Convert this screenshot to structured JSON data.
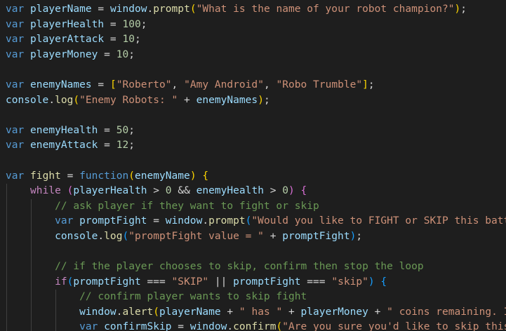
{
  "editor": {
    "language": "javascript",
    "theme": "dark",
    "colors": {
      "background": "#1e1e1e",
      "keyword": "#569cd6",
      "control": "#c586c0",
      "variable": "#9cdcfe",
      "function": "#dcdcaa",
      "string": "#ce9178",
      "number": "#b5cea8",
      "comment": "#6a9955",
      "bracket_level1": "#ffd700",
      "bracket_level2": "#da70d6",
      "bracket_level3": "#179fff"
    },
    "lines": [
      {
        "guides": 0,
        "tokens": [
          {
            "t": "kw",
            "v": "var"
          },
          {
            "t": "op",
            "v": " "
          },
          {
            "t": "var",
            "v": "playerName"
          },
          {
            "t": "op",
            "v": " = "
          },
          {
            "t": "var",
            "v": "window"
          },
          {
            "t": "op",
            "v": "."
          },
          {
            "t": "fn",
            "v": "prompt"
          },
          {
            "t": "br1",
            "v": "("
          },
          {
            "t": "str",
            "v": "\"What is the name of your robot champion?\""
          },
          {
            "t": "br1",
            "v": ")"
          },
          {
            "t": "op",
            "v": ";"
          }
        ]
      },
      {
        "guides": 0,
        "tokens": [
          {
            "t": "kw",
            "v": "var"
          },
          {
            "t": "op",
            "v": " "
          },
          {
            "t": "var",
            "v": "playerHealth"
          },
          {
            "t": "op",
            "v": " = "
          },
          {
            "t": "num",
            "v": "100"
          },
          {
            "t": "op",
            "v": ";"
          }
        ]
      },
      {
        "guides": 0,
        "tokens": [
          {
            "t": "kw",
            "v": "var"
          },
          {
            "t": "op",
            "v": " "
          },
          {
            "t": "var",
            "v": "playerAttack"
          },
          {
            "t": "op",
            "v": " = "
          },
          {
            "t": "num",
            "v": "10"
          },
          {
            "t": "op",
            "v": ";"
          }
        ]
      },
      {
        "guides": 0,
        "tokens": [
          {
            "t": "kw",
            "v": "var"
          },
          {
            "t": "op",
            "v": " "
          },
          {
            "t": "var",
            "v": "playerMoney"
          },
          {
            "t": "op",
            "v": " = "
          },
          {
            "t": "num",
            "v": "10"
          },
          {
            "t": "op",
            "v": ";"
          }
        ]
      },
      {
        "guides": 0,
        "tokens": []
      },
      {
        "guides": 0,
        "tokens": [
          {
            "t": "kw",
            "v": "var"
          },
          {
            "t": "op",
            "v": " "
          },
          {
            "t": "var",
            "v": "enemyNames"
          },
          {
            "t": "op",
            "v": " = "
          },
          {
            "t": "br1",
            "v": "["
          },
          {
            "t": "str",
            "v": "\"Roberto\""
          },
          {
            "t": "op",
            "v": ", "
          },
          {
            "t": "str",
            "v": "\"Amy Android\""
          },
          {
            "t": "op",
            "v": ", "
          },
          {
            "t": "str",
            "v": "\"Robo Trumble\""
          },
          {
            "t": "br1",
            "v": "]"
          },
          {
            "t": "op",
            "v": ";"
          }
        ]
      },
      {
        "guides": 0,
        "tokens": [
          {
            "t": "var",
            "v": "console"
          },
          {
            "t": "op",
            "v": "."
          },
          {
            "t": "fn",
            "v": "log"
          },
          {
            "t": "br1",
            "v": "("
          },
          {
            "t": "str",
            "v": "\"Enemy Robots: \""
          },
          {
            "t": "op",
            "v": " + "
          },
          {
            "t": "var",
            "v": "enemyNames"
          },
          {
            "t": "br1",
            "v": ")"
          },
          {
            "t": "op",
            "v": ";"
          }
        ]
      },
      {
        "guides": 0,
        "tokens": []
      },
      {
        "guides": 0,
        "tokens": [
          {
            "t": "kw",
            "v": "var"
          },
          {
            "t": "op",
            "v": " "
          },
          {
            "t": "var",
            "v": "enemyHealth"
          },
          {
            "t": "op",
            "v": " = "
          },
          {
            "t": "num",
            "v": "50"
          },
          {
            "t": "op",
            "v": ";"
          }
        ]
      },
      {
        "guides": 0,
        "tokens": [
          {
            "t": "kw",
            "v": "var"
          },
          {
            "t": "op",
            "v": " "
          },
          {
            "t": "var",
            "v": "enemyAttack"
          },
          {
            "t": "op",
            "v": " = "
          },
          {
            "t": "num",
            "v": "12"
          },
          {
            "t": "op",
            "v": ";"
          }
        ]
      },
      {
        "guides": 0,
        "tokens": []
      },
      {
        "guides": 0,
        "tokens": [
          {
            "t": "kw",
            "v": "var"
          },
          {
            "t": "op",
            "v": " "
          },
          {
            "t": "fn",
            "v": "fight"
          },
          {
            "t": "op",
            "v": " = "
          },
          {
            "t": "kw",
            "v": "function"
          },
          {
            "t": "br1",
            "v": "("
          },
          {
            "t": "var",
            "v": "enemyName"
          },
          {
            "t": "br1",
            "v": ")"
          },
          {
            "t": "op",
            "v": " "
          },
          {
            "t": "br1",
            "v": "{"
          }
        ]
      },
      {
        "guides": 1,
        "tokens": [
          {
            "t": "op",
            "v": "    "
          },
          {
            "t": "ctl",
            "v": "while"
          },
          {
            "t": "op",
            "v": " "
          },
          {
            "t": "br2",
            "v": "("
          },
          {
            "t": "var",
            "v": "playerHealth"
          },
          {
            "t": "op",
            "v": " > "
          },
          {
            "t": "num",
            "v": "0"
          },
          {
            "t": "op",
            "v": " && "
          },
          {
            "t": "var",
            "v": "enemyHealth"
          },
          {
            "t": "op",
            "v": " > "
          },
          {
            "t": "num",
            "v": "0"
          },
          {
            "t": "br2",
            "v": ")"
          },
          {
            "t": "op",
            "v": " "
          },
          {
            "t": "br2",
            "v": "{"
          }
        ]
      },
      {
        "guides": 2,
        "tokens": [
          {
            "t": "op",
            "v": "        "
          },
          {
            "t": "cmt",
            "v": "// ask player if they want to fight or skip"
          }
        ]
      },
      {
        "guides": 2,
        "tokens": [
          {
            "t": "op",
            "v": "        "
          },
          {
            "t": "kw",
            "v": "var"
          },
          {
            "t": "op",
            "v": " "
          },
          {
            "t": "var",
            "v": "promptFight"
          },
          {
            "t": "op",
            "v": " = "
          },
          {
            "t": "var",
            "v": "window"
          },
          {
            "t": "op",
            "v": "."
          },
          {
            "t": "fn",
            "v": "prompt"
          },
          {
            "t": "br3",
            "v": "("
          },
          {
            "t": "str",
            "v": "\"Would you like to FIGHT or SKIP this batt"
          }
        ]
      },
      {
        "guides": 2,
        "tokens": [
          {
            "t": "op",
            "v": "        "
          },
          {
            "t": "var",
            "v": "console"
          },
          {
            "t": "op",
            "v": "."
          },
          {
            "t": "fn",
            "v": "log"
          },
          {
            "t": "br3",
            "v": "("
          },
          {
            "t": "str",
            "v": "\"promptFight value = \""
          },
          {
            "t": "op",
            "v": " + "
          },
          {
            "t": "var",
            "v": "promptFight"
          },
          {
            "t": "br3",
            "v": ")"
          },
          {
            "t": "op",
            "v": ";"
          }
        ]
      },
      {
        "guides": 2,
        "tokens": []
      },
      {
        "guides": 2,
        "tokens": [
          {
            "t": "op",
            "v": "        "
          },
          {
            "t": "cmt",
            "v": "// if the player chooses to skip, confirm then stop the loop"
          }
        ]
      },
      {
        "guides": 2,
        "tokens": [
          {
            "t": "op",
            "v": "        "
          },
          {
            "t": "ctl",
            "v": "if"
          },
          {
            "t": "br3",
            "v": "("
          },
          {
            "t": "var",
            "v": "promptFight"
          },
          {
            "t": "op",
            "v": " === "
          },
          {
            "t": "str",
            "v": "\"SKIP\""
          },
          {
            "t": "op",
            "v": " || "
          },
          {
            "t": "var",
            "v": "promptFight"
          },
          {
            "t": "op",
            "v": " === "
          },
          {
            "t": "str",
            "v": "\"skip\""
          },
          {
            "t": "br3",
            "v": ")"
          },
          {
            "t": "op",
            "v": " "
          },
          {
            "t": "br3",
            "v": "{"
          }
        ]
      },
      {
        "guides": 3,
        "tokens": [
          {
            "t": "op",
            "v": "            "
          },
          {
            "t": "cmt",
            "v": "// confirm player wants to skip fight"
          }
        ]
      },
      {
        "guides": 3,
        "tokens": [
          {
            "t": "op",
            "v": "            "
          },
          {
            "t": "var",
            "v": "window"
          },
          {
            "t": "op",
            "v": "."
          },
          {
            "t": "fn",
            "v": "alert"
          },
          {
            "t": "br1",
            "v": "("
          },
          {
            "t": "var",
            "v": "playerName"
          },
          {
            "t": "op",
            "v": " + "
          },
          {
            "t": "str",
            "v": "\" has \""
          },
          {
            "t": "op",
            "v": " + "
          },
          {
            "t": "var",
            "v": "playerMoney"
          },
          {
            "t": "op",
            "v": " + "
          },
          {
            "t": "str",
            "v": "\" coins remaining. I"
          }
        ]
      },
      {
        "guides": 3,
        "tokens": [
          {
            "t": "op",
            "v": "            "
          },
          {
            "t": "kw",
            "v": "var"
          },
          {
            "t": "op",
            "v": " "
          },
          {
            "t": "var",
            "v": "confirmSkip"
          },
          {
            "t": "op",
            "v": " = "
          },
          {
            "t": "var",
            "v": "window"
          },
          {
            "t": "op",
            "v": "."
          },
          {
            "t": "fn",
            "v": "confirm"
          },
          {
            "t": "br1",
            "v": "("
          },
          {
            "t": "str",
            "v": "\"Are you sure you'd like to skip this"
          }
        ]
      }
    ]
  }
}
